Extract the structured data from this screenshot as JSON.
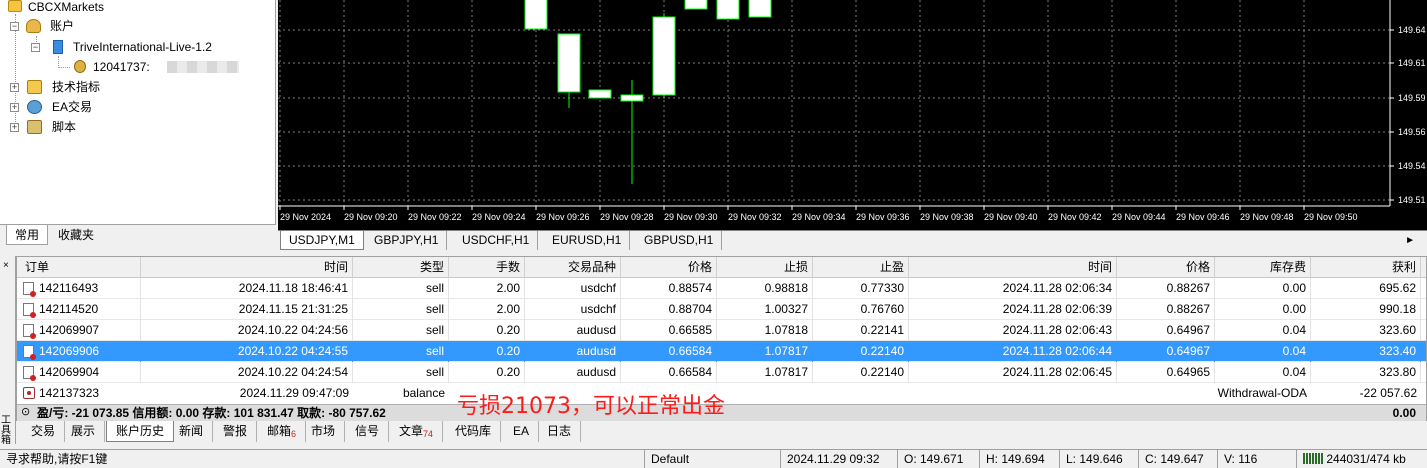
{
  "navigator": {
    "root_label": "CBCXMarkets",
    "accounts_label": "账户",
    "server_label": "TriveInternational-Live-1.2",
    "account_number": "12041737:",
    "indicators_label": "技术指标",
    "ea_label": "EA交易",
    "scripts_label": "脚本",
    "tabs": [
      "常用",
      "收藏夹"
    ]
  },
  "chart": {
    "colors": {
      "background": "#000000",
      "candle": "#00ff00",
      "grid": "#808080",
      "text": "#ffffff"
    },
    "price_labels": [
      "149.64",
      "149.61",
      "149.59",
      "149.56",
      "149.54",
      "149.51"
    ],
    "time_labels": [
      "29 Nov 2024",
      "29 Nov 09:20",
      "29 Nov 09:22",
      "29 Nov 09:24",
      "29 Nov 09:26",
      "29 Nov 09:28",
      "29 Nov 09:30",
      "29 Nov 09:32",
      "29 Nov 09:34",
      "29 Nov 09:36",
      "29 Nov 09:38",
      "29 Nov 09:40",
      "29 Nov 09:42",
      "29 Nov 09:44",
      "29 Nov 09:46",
      "29 Nov 09:48",
      "29 Nov 09:50"
    ],
    "tabs": [
      "USDJPY,M1",
      "GBPJPY,H1",
      "USDCHF,H1",
      "EURUSD,H1",
      "GBPUSD,H1"
    ]
  },
  "table": {
    "headers": [
      "订单",
      "时间",
      "类型",
      "手数",
      "交易品种",
      "价格",
      "止损",
      "止盈",
      "时间",
      "价格",
      "库存费",
      "获利"
    ],
    "rows": [
      [
        "142116493",
        "2024.11.18 18:46:41",
        "sell",
        "2.00",
        "usdchf",
        "0.88574",
        "0.98818",
        "0.77330",
        "2024.11.28 02:06:34",
        "0.88267",
        "0.00",
        "695.62"
      ],
      [
        "142114520",
        "2024.11.15 21:31:25",
        "sell",
        "2.00",
        "usdchf",
        "0.88704",
        "1.00327",
        "0.76760",
        "2024.11.28 02:06:39",
        "0.88267",
        "0.00",
        "990.18"
      ],
      [
        "142069907",
        "2024.10.22 04:24:56",
        "sell",
        "0.20",
        "audusd",
        "0.66585",
        "1.07818",
        "0.22141",
        "2024.11.28 02:06:43",
        "0.64967",
        "0.04",
        "323.60"
      ],
      [
        "142069906",
        "2024.10.22 04:24:55",
        "sell",
        "0.20",
        "audusd",
        "0.66584",
        "1.07817",
        "0.22140",
        "2024.11.28 02:06:44",
        "0.64967",
        "0.04",
        "323.40"
      ],
      [
        "142069904",
        "2024.10.22 04:24:54",
        "sell",
        "0.20",
        "audusd",
        "0.66584",
        "1.07817",
        "0.22140",
        "2024.11.28 02:06:45",
        "0.64965",
        "0.04",
        "323.80"
      ]
    ],
    "balance_row": {
      "order": "142137323",
      "time": "2024.11.29 09:47:09",
      "type": "balance",
      "comment": "Withdrawal-ODA",
      "profit": "-22 057.62"
    },
    "summary": "盈/亏: -21 073.85  信用额: 0.00  存款: 101 831.47  取款: -80 757.62",
    "summary_total": "0.00",
    "annotation": "亏损21073，可以正常出金"
  },
  "terminal_tabs": [
    "交易",
    "展示",
    "账户历史",
    "新闻",
    "警报",
    "邮箱",
    "市场",
    "信号",
    "文章",
    "代码库",
    "EA",
    "日志"
  ],
  "terminal_tab_badges": {
    "mail": "6",
    "articles": "74"
  },
  "terminal_side_label": "工具箱",
  "statusbar": {
    "help": "寻求帮助,请按F1键",
    "profile": "Default",
    "datetime": "2024.11.29 09:32",
    "open": "O: 149.671",
    "high": "H: 149.694",
    "low": "L: 149.646",
    "close": "C: 149.647",
    "volume": "V: 116",
    "traffic": "244031/474 kb"
  }
}
